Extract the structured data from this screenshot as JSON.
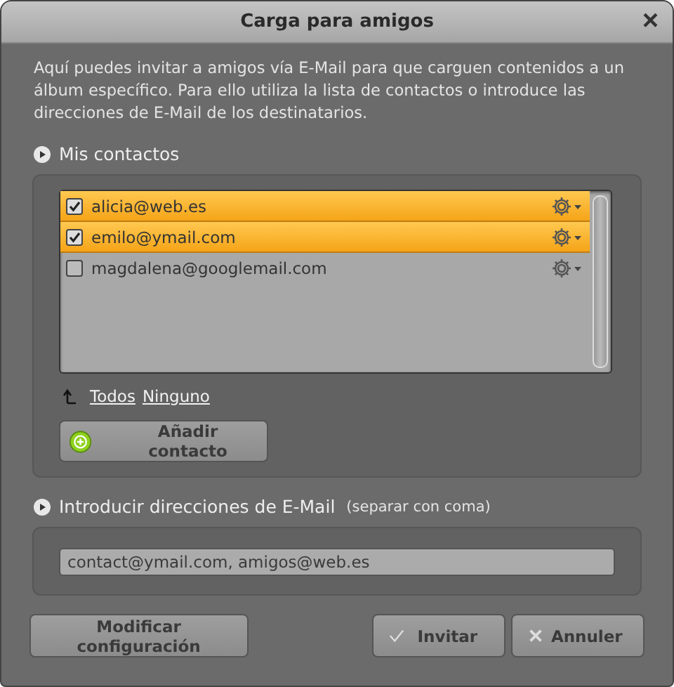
{
  "window": {
    "title": "Carga para amigos",
    "close": "×"
  },
  "description": "Aquí puedes invitar a amigos vía E-Mail para que carguen contenidos a un álbum específico. Para ello utiliza la lista de contactos o introduce las direcciones de E-Mail de los destinatarios.",
  "contacts_section": {
    "title": "Mis contactos",
    "contacts": [
      {
        "email": "alicia@web.es",
        "checked": true,
        "selected": true
      },
      {
        "email": "emilo@ymail.com",
        "checked": true,
        "selected": true
      },
      {
        "email": "magdalena@googlemail.com",
        "checked": false,
        "selected": false
      }
    ],
    "links": [
      "Todos",
      "Ninguno"
    ],
    "add_button": "Añadir contacto"
  },
  "email_section": {
    "title": "Introducir direcciones de E-Mail",
    "hint": "(separar con coma)",
    "value": "contact@ymail.com, amigos@web.es"
  },
  "buttons": [
    {
      "label": "Modificar configuración",
      "kind": "plain"
    },
    {
      "label": "Invitar",
      "kind": "ok"
    },
    {
      "label": "Annuler",
      "kind": "cancel"
    }
  ]
}
